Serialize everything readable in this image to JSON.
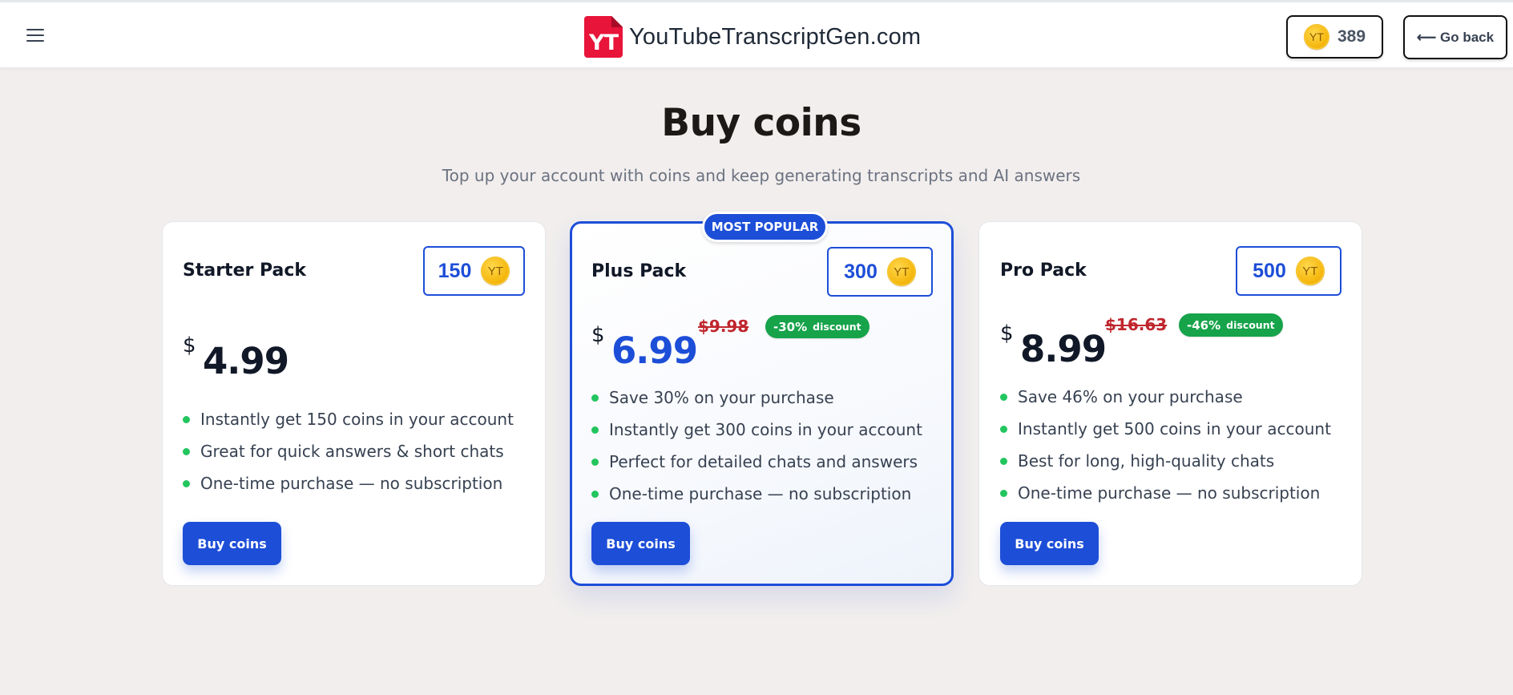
{
  "header": {
    "brand_logo_text": "YT",
    "brand_name": "YouTubeTranscriptGen.com",
    "coin_icon_text": "YT",
    "coin_balance": "389",
    "go_back_label": "⟵ Go back"
  },
  "page": {
    "title": "Buy coins",
    "subtitle": "Top up your account with coins and keep generating transcripts and AI answers"
  },
  "colors": {
    "accent": "#1d4ed8",
    "discount_green": "#16a34a",
    "bullet_green": "#22c55e",
    "strike_red": "#c0262d",
    "brand_red": "#e8143a",
    "background": "#f1eeed"
  },
  "plans": [
    {
      "name": "Starter Pack",
      "coins": "150",
      "currency": "$",
      "price": "4.99",
      "features": [
        "Instantly get 150 coins in your account",
        "Great for quick answers & short chats",
        "One-time purchase — no subscription"
      ],
      "button_label": "Buy coins"
    },
    {
      "badge": "MOST POPULAR",
      "name": "Plus Pack",
      "coins": "300",
      "currency": "$",
      "price": "6.99",
      "old_price": "$9.98",
      "discount": "-30%",
      "discount_label": "discount",
      "features": [
        "Save 30% on your purchase",
        "Instantly get 300 coins in your account",
        "Perfect for detailed chats and answers",
        "One-time purchase — no subscription"
      ],
      "button_label": "Buy coins"
    },
    {
      "name": "Pro Pack",
      "coins": "500",
      "currency": "$",
      "price": "8.99",
      "old_price": "$16.63",
      "discount": "-46%",
      "discount_label": "discount",
      "features": [
        "Save 46% on your purchase",
        "Instantly get 500 coins in your account",
        "Best for long, high-quality chats",
        "One-time purchase — no subscription"
      ],
      "button_label": "Buy coins"
    }
  ]
}
